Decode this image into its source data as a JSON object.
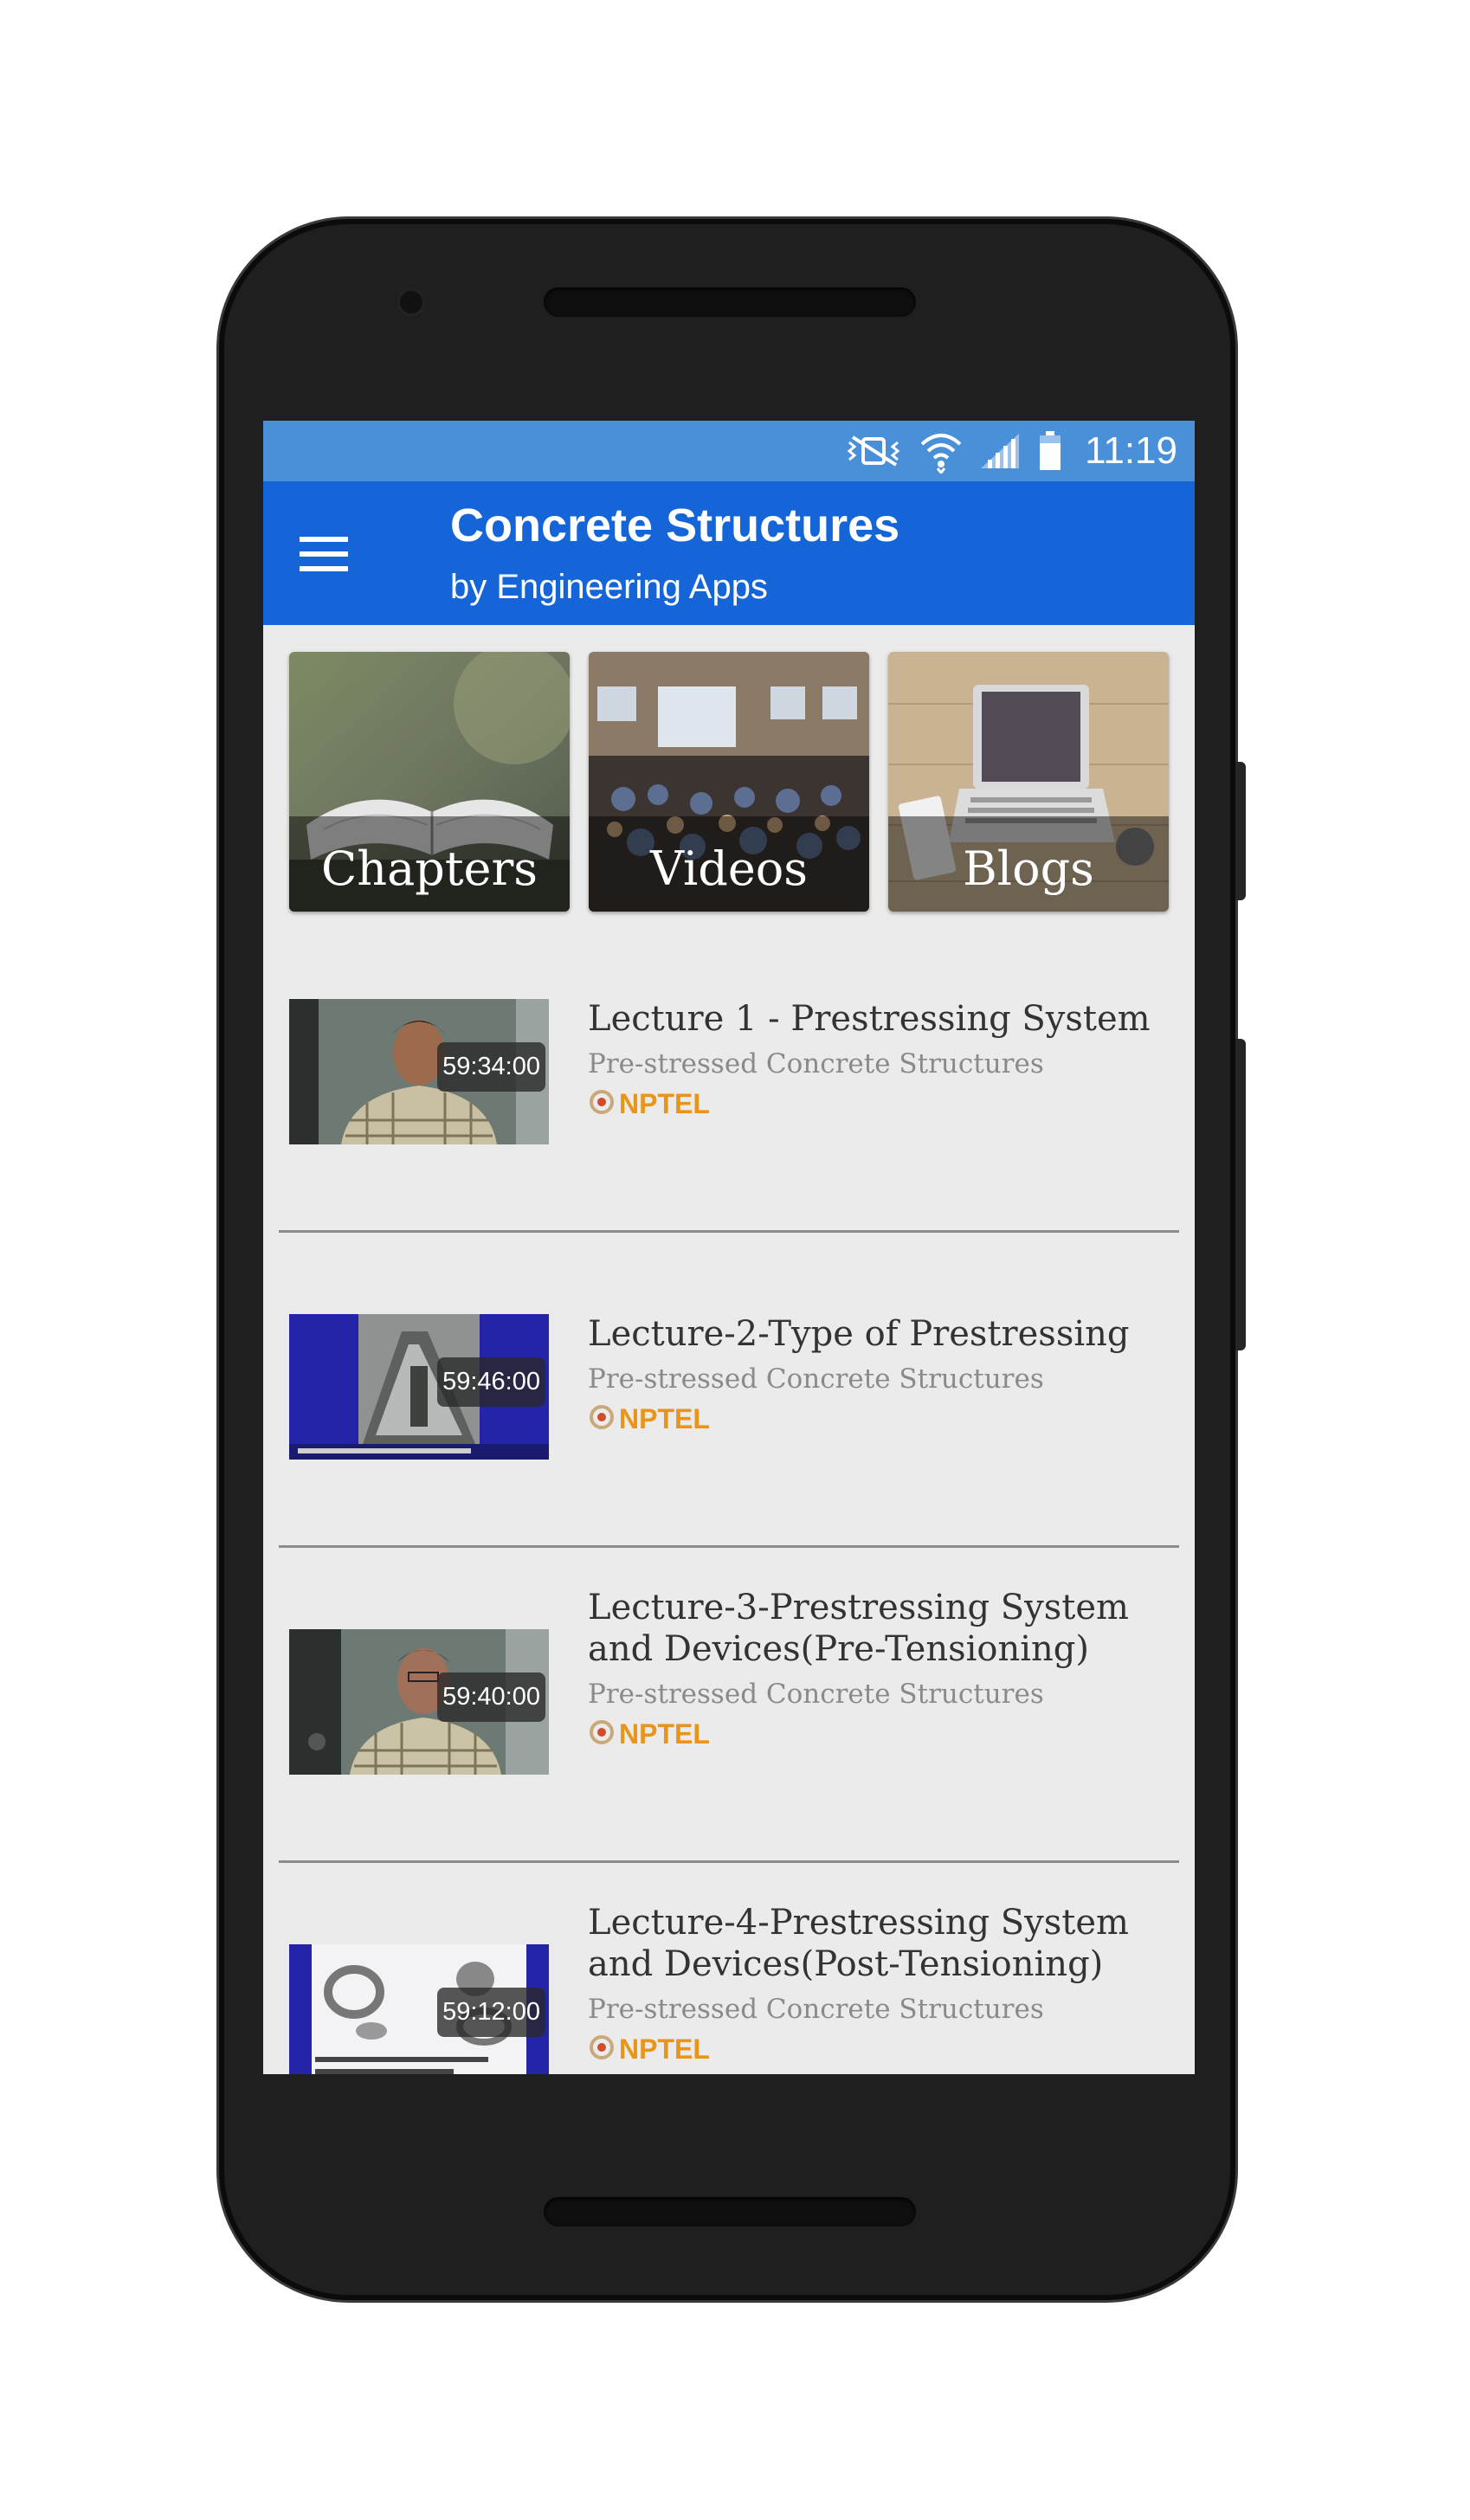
{
  "status_bar": {
    "time": "11:19",
    "icons": [
      "vibrate-icon",
      "wifi-icon",
      "signal-icon",
      "battery-icon"
    ]
  },
  "app_bar": {
    "title": "Concrete Structures",
    "subtitle": "by Engineering Apps",
    "menu_icon": "hamburger-menu-icon",
    "color": "#1565d8"
  },
  "tiles": [
    {
      "label": "Chapters"
    },
    {
      "label": "Videos"
    },
    {
      "label": "Blogs"
    }
  ],
  "videos": [
    {
      "title": "Lecture 1 - Prestressing System",
      "course": "Pre-stressed Concrete Structures",
      "source": "NPTEL",
      "duration": "59:34:00"
    },
    {
      "title": "Lecture-2-Type of Prestressing",
      "course": "Pre-stressed Concrete Structures",
      "source": "NPTEL",
      "duration": "59:46:00"
    },
    {
      "title": "Lecture-3-Prestressing System and Devices(Pre-Tensioning)",
      "course": "Pre-stressed Concrete Structures",
      "source": "NPTEL",
      "duration": "59:40:00"
    },
    {
      "title": "Lecture-4-Prestressing System and Devices(Post-Tensioning)",
      "course": "Pre-stressed Concrete Structures",
      "source": "NPTEL",
      "duration": "59:12:00"
    }
  ],
  "colors": {
    "status_bar": "#4a90d9",
    "source_label": "#e8951a",
    "background": "#ebebeb"
  }
}
